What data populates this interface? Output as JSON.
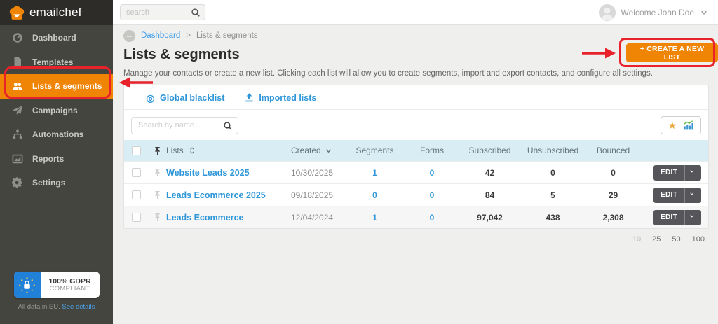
{
  "colors": {
    "accent_orange": "#f08505",
    "annotation_red": "#e8212b",
    "link_blue": "#2e96d8",
    "table_header_blue": "#d9edf5",
    "gdpr_blue": "#2180d8"
  },
  "sidebar": {
    "logo_text": "emailchef",
    "items": [
      {
        "label": "Dashboard",
        "icon": "dashboard-icon"
      },
      {
        "label": "Templates",
        "icon": "templates-icon"
      },
      {
        "label": "Lists & segments",
        "icon": "people-icon",
        "active": true
      },
      {
        "label": "Campaigns",
        "icon": "paper-plane-icon"
      },
      {
        "label": "Automations",
        "icon": "sitemap-icon"
      },
      {
        "label": "Reports",
        "icon": "report-chart-icon"
      },
      {
        "label": "Settings",
        "icon": "gears-icon"
      }
    ],
    "gdpr_badge": {
      "line1": "100% GDPR",
      "line2": "COMPLIANT"
    },
    "gdpr_footer": {
      "text": "All data in EU. ",
      "link": "See details"
    }
  },
  "topbar": {
    "search_placeholder": "search",
    "user": {
      "welcome_text": "Welcome John Doe"
    }
  },
  "breadcrumb": {
    "back_glyph": "←",
    "home": "Dashboard",
    "separator": ">",
    "current": "Lists & segments"
  },
  "page": {
    "title": "Lists & segments",
    "description": "Manage your contacts or create a new list. Clicking each list will allow you to create segments, import and export contacts, and configure all settings.",
    "create_button_label": "+ CREATE A NEW LIST"
  },
  "panel": {
    "links": [
      {
        "label": "Global blacklist",
        "icon": "blacklist-icon",
        "glyph": "◎"
      },
      {
        "label": "Imported lists",
        "icon": "upload-icon"
      }
    ],
    "search_placeholder": "Search by name...",
    "star_glyph": "★",
    "table": {
      "headers": {
        "lists": "Lists",
        "created": "Created",
        "segments": "Segments",
        "forms": "Forms",
        "subscribed": "Subscribed",
        "unsubscribed": "Unsubscribed",
        "bounced": "Bounced"
      },
      "edit_button_label": "EDIT",
      "rows": [
        {
          "name": "Website Leads 2025",
          "created": "10/30/2025",
          "segments": "1",
          "forms": "0",
          "subscribed": "42",
          "unsubscribed": "0",
          "bounced": "0"
        },
        {
          "name": "Leads Ecommerce 2025",
          "created": "09/18/2025",
          "segments": "0",
          "forms": "0",
          "subscribed": "84",
          "unsubscribed": "5",
          "bounced": "29"
        },
        {
          "name": "Leads Ecommerce",
          "created": "12/04/2024",
          "segments": "1",
          "forms": "0",
          "subscribed": "97,042",
          "unsubscribed": "438",
          "bounced": "2,308"
        }
      ]
    },
    "page_sizes": [
      "10",
      "25",
      "50",
      "100"
    ]
  }
}
